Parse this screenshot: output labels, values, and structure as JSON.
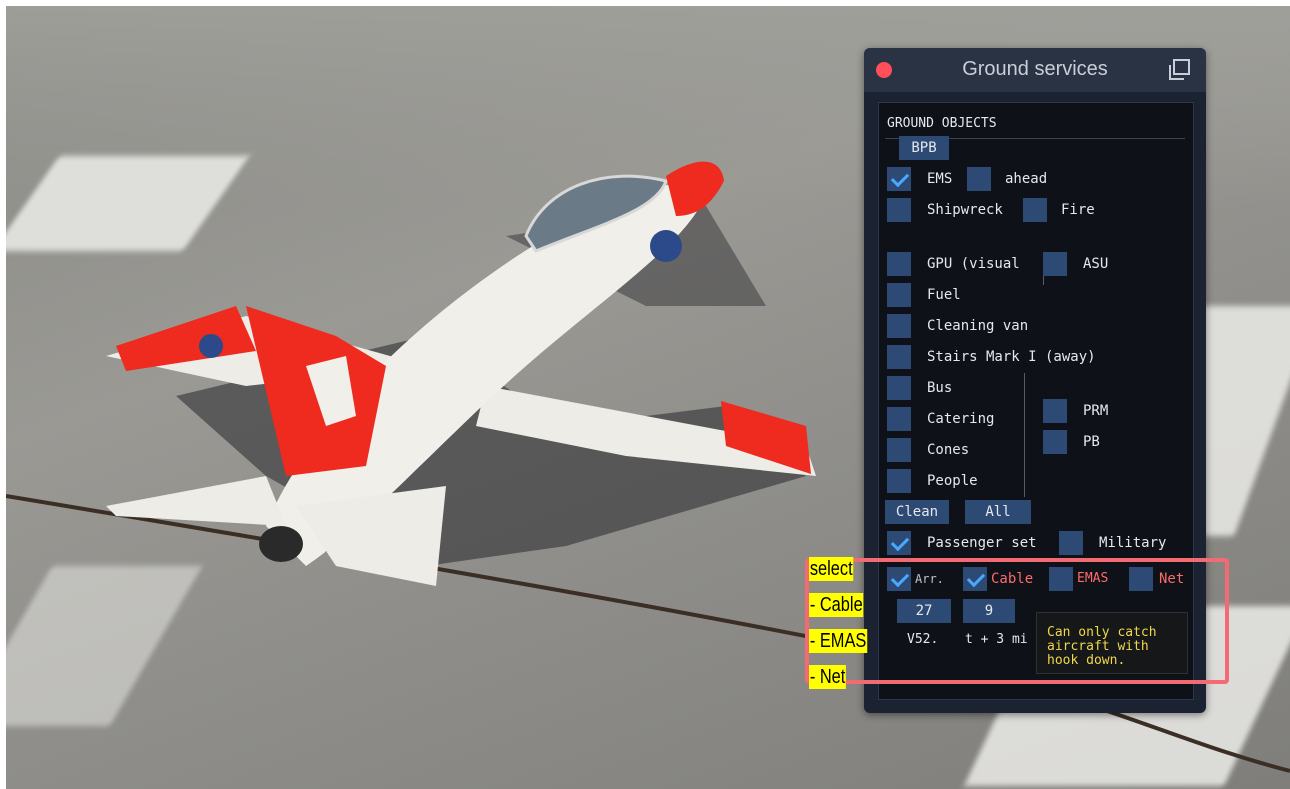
{
  "window": {
    "title": "Ground services",
    "section_title": "GROUND OBJECTS"
  },
  "ground_objects": {
    "bpb_label": "BPB",
    "ems": {
      "label": "EMS",
      "checked": true
    },
    "ahead": {
      "label": "ahead",
      "checked": false
    },
    "shipwreck": {
      "label": "Shipwreck",
      "checked": false
    },
    "fire": {
      "label": "Fire",
      "checked": false
    },
    "gpu": {
      "label": "GPU (visual",
      "checked": false
    },
    "asu": {
      "label": "ASU",
      "checked": false
    },
    "fuel": {
      "label": "Fuel",
      "checked": false
    },
    "cleaning_van": {
      "label": "Cleaning van",
      "checked": false
    },
    "stairs": {
      "label": "Stairs Mark I (away)",
      "checked": false
    },
    "bus": {
      "label": "Bus",
      "checked": false
    },
    "catering": {
      "label": "Catering",
      "checked": false
    },
    "cones": {
      "label": "Cones",
      "checked": false
    },
    "people": {
      "label": "People",
      "checked": false
    },
    "prm": {
      "label": "PRM",
      "checked": false
    },
    "pb": {
      "label": "PB",
      "checked": false
    },
    "clean_label": "Clean",
    "all_label": "All",
    "passenger_set": {
      "label": "Passenger set",
      "checked": true
    },
    "military": {
      "label": "Military",
      "checked": false
    }
  },
  "arresting": {
    "arr": {
      "label": "Arr.",
      "checked": true
    },
    "cable": {
      "label": "Cable",
      "checked": true
    },
    "emas": {
      "label": "EMAS",
      "checked": false
    },
    "net": {
      "label": "Net",
      "checked": false
    },
    "runway_value": "27",
    "number_value": "9",
    "status_text": "V52.",
    "time_text": "t + 3 mi"
  },
  "tooltip": {
    "text": "Can only catch\naircraft with\nhook down."
  },
  "annotation": {
    "lines": [
      "select",
      "- Cable",
      "- EMAS",
      "- Net"
    ]
  },
  "colors": {
    "window_bg": "#1b2332",
    "panel_bg": "#0e1118",
    "checkbox": "#2d4a75",
    "check_mark": "#4aa8ff",
    "warning_text": "#ff6a6a",
    "tooltip_text": "#f0d84a",
    "annotation_border": "#f26a72",
    "annotation_highlight": "#ffff00",
    "close_button": "#ff4f5a"
  },
  "icons": [
    "close-icon",
    "popout-icon",
    "checkmark-icon"
  ]
}
